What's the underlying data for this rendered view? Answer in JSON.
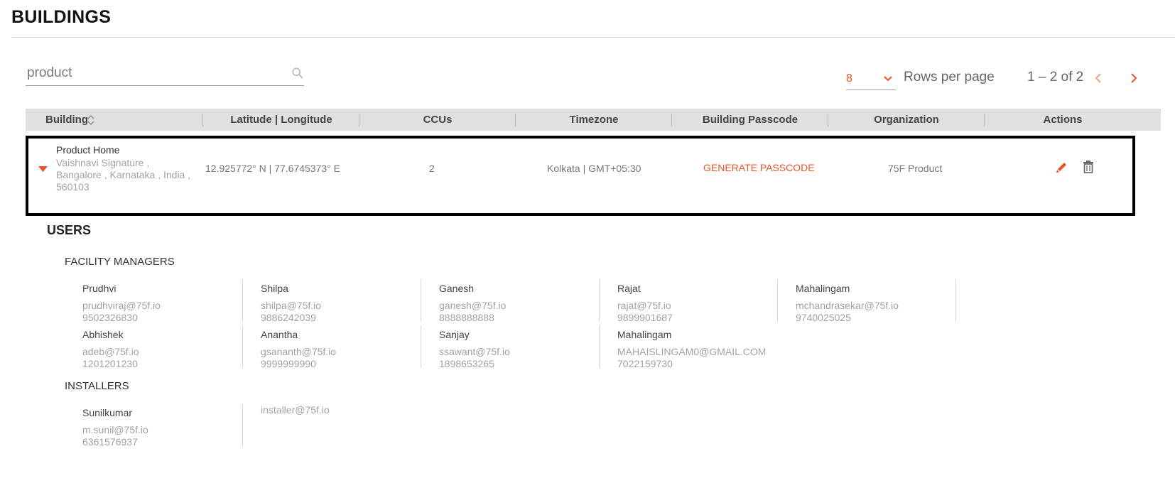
{
  "page": {
    "title": "BUILDINGS"
  },
  "search": {
    "value": "product"
  },
  "pagination": {
    "rows_value": "8",
    "rows_label": "Rows per page",
    "range": "1 – 2 of 2"
  },
  "table": {
    "headers": [
      "Building",
      "Latitude | Longitude",
      "CCUs",
      "Timezone",
      "Building Passcode",
      "Organization",
      "Actions"
    ],
    "row": {
      "name": "Product Home",
      "address": "Vaishnavi Signature , Bangalore , Karnataka , India , 560103",
      "latlong": "12.925772° N | 77.6745373° E",
      "ccus": "2",
      "timezone": "Kolkata | GMT+05:30",
      "passcode_action": "GENERATE PASSCODE",
      "organization": "75F Product"
    }
  },
  "users": {
    "title": "USERS",
    "facility_managers": {
      "title": "FACILITY MANAGERS",
      "people": [
        {
          "name": "Prudhvi",
          "email": "prudhviraj@75f.io",
          "phone": "9502326830"
        },
        {
          "name": "Shilpa",
          "email": "shilpa@75f.io",
          "phone": "9886242039"
        },
        {
          "name": "Ganesh",
          "email": "ganesh@75f.io",
          "phone": "8888888888"
        },
        {
          "name": "Rajat",
          "email": "rajat@75f.io",
          "phone": "9899901687"
        },
        {
          "name": "Mahalingam",
          "email": "mchandrasekar@75f.io",
          "phone": "9740025025"
        },
        {
          "name": "Abhishek",
          "email": "adeb@75f.io",
          "phone": "1201201230"
        },
        {
          "name": "Anantha",
          "email": "gsananth@75f.io",
          "phone": "9999999990"
        },
        {
          "name": "Sanjay",
          "email": "ssawant@75f.io",
          "phone": "1898653265"
        },
        {
          "name": "Mahalingam",
          "email": "MAHAISLINGAM0@GMAIL.COM",
          "phone": "7022159730"
        }
      ]
    },
    "installers": {
      "title": "INSTALLERS",
      "people": [
        {
          "name": "Sunilkumar",
          "email": "m.sunil@75f.io",
          "phone": "6361576937"
        },
        {
          "name": "",
          "email": "installer@75f.io",
          "phone": ""
        }
      ]
    }
  },
  "colors": {
    "accent": "#e8542a",
    "header_bg": "#e0e0e0",
    "muted_text": "#a3a3a3"
  },
  "icons": [
    "search-icon",
    "chevron-down-icon",
    "chevron-left-icon",
    "chevron-right-icon",
    "sort-icon",
    "caret-down-icon",
    "pencil-icon",
    "trash-icon"
  ]
}
